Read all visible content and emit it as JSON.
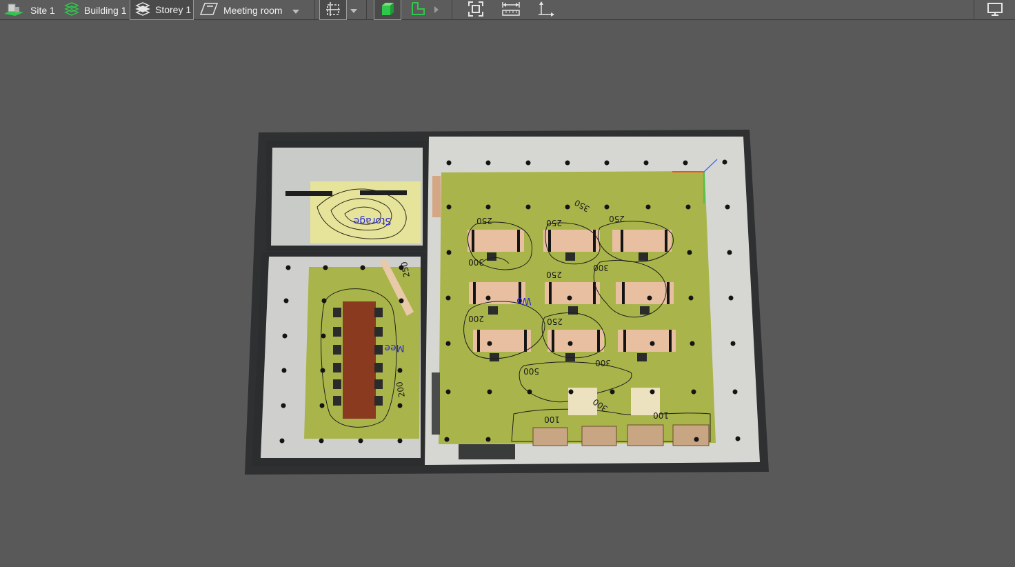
{
  "toolbar": {
    "breadcrumb": [
      {
        "label": "Site 1",
        "icon": "site-icon"
      },
      {
        "label": "Building 1",
        "icon": "building-icon"
      },
      {
        "label": "Storey 1",
        "icon": "storey-icon"
      },
      {
        "label": "Meeting room",
        "icon": "room-icon"
      }
    ],
    "tools": [
      "select-area-icon",
      "solid-view-icon",
      "floor-outline-icon",
      "zoom-fit-icon",
      "measure-icon",
      "dimension-icon",
      "monitor-icon"
    ],
    "accent_color": "#2ec84a"
  },
  "floorplan": {
    "rooms": [
      {
        "label": "Storage"
      },
      {
        "label": "Mee"
      },
      {
        "label": "Wo"
      }
    ],
    "contours": [
      "250",
      "250",
      "250",
      "300",
      "350",
      "250",
      "300",
      "250",
      "200",
      "250",
      "300",
      "500",
      "200",
      "300",
      "100",
      "100"
    ],
    "floor_color": "#a9b54b",
    "storage_floor_color": "#e6e39a",
    "wall_color": "#2e3031"
  }
}
